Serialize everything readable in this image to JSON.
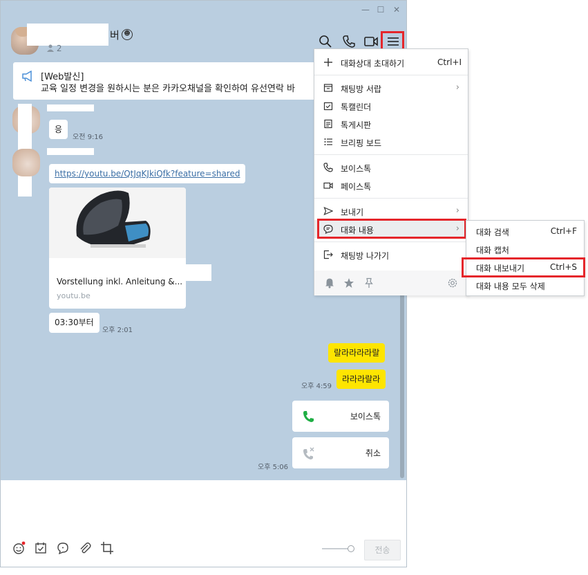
{
  "window": {
    "minimize_glyph": "—",
    "maximize_glyph": "☐",
    "close_glyph": "✕"
  },
  "room": {
    "name_suffix": "버",
    "member_count": "2"
  },
  "notice": {
    "title": "[Web발신]",
    "body": "교육 일정 변경을 원하시는 분은 카카오채널을 확인하여 유선연락 바"
  },
  "messages": {
    "m1_text": "응",
    "m1_time": "오전 9:16",
    "m2_link": "https://youtu.be/QtJqKJkiQfk?feature=shared",
    "preview_title": "Vorstellung inkl. Anleitung &...",
    "preview_domain": "youtu.be",
    "m3_text": "03:30부터",
    "m3_time": "오후 2:01",
    "y1_text": "랄라라라라랄",
    "y2_text": "라라라랄라",
    "y_time": "오후 4:59",
    "call1_label": "보이스톡",
    "call2_label": "취소",
    "call_time": "오후 5:06"
  },
  "input": {
    "send_label": "전송"
  },
  "menu": {
    "items": [
      {
        "label": "대화상대 초대하기",
        "shortcut": "Ctrl+I"
      },
      {
        "label": "채팅방 서랍"
      },
      {
        "label": "톡캘린더"
      },
      {
        "label": "톡게시판"
      },
      {
        "label": "브리핑 보드"
      },
      {
        "label": "보이스톡"
      },
      {
        "label": "페이스톡"
      },
      {
        "label": "보내기"
      },
      {
        "label": "대화 내용"
      },
      {
        "label": "채팅방 나가기"
      }
    ]
  },
  "submenu": {
    "items": [
      {
        "label": "대화 검색",
        "shortcut": "Ctrl+F"
      },
      {
        "label": "대화 캡처"
      },
      {
        "label": "대화 내보내기",
        "shortcut": "Ctrl+S"
      },
      {
        "label": "대화 내용 모두 삭제"
      }
    ]
  },
  "colors": {
    "chat_bg": "#bacee0",
    "bubble_yellow": "#fee500",
    "highlight_red": "#e5262b",
    "call_green": "#1fae44"
  }
}
